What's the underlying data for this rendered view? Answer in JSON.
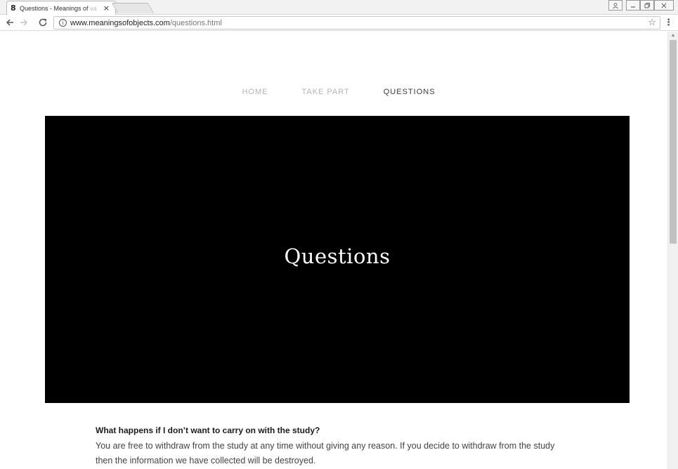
{
  "browser": {
    "tab_title": "Questions - Meanings of",
    "tab_title_fade": "va",
    "tab_close_glyph": "×",
    "url_host": "www.meaningsofobjects.com",
    "url_path": "/questions.html",
    "window_controls": [
      "user-icon",
      "minimize-icon",
      "restore-icon",
      "close-icon"
    ]
  },
  "site": {
    "nav": [
      {
        "label": "HOME",
        "active": false
      },
      {
        "label": "TAKE PART",
        "active": false
      },
      {
        "label": "QUESTIONS",
        "active": true
      }
    ],
    "hero_title": "Questions",
    "faq": [
      {
        "question": "What happens if I don’t want to carry on with the study?",
        "answer": "You are free to withdraw from the study at any time without giving any reason. If you decide to withdraw from the study then the information we have collected will be destroyed."
      }
    ]
  },
  "colors": {
    "hero_background": "#000000",
    "nav_inactive": "#b5b5b5",
    "nav_active": "#3a3a3a"
  }
}
